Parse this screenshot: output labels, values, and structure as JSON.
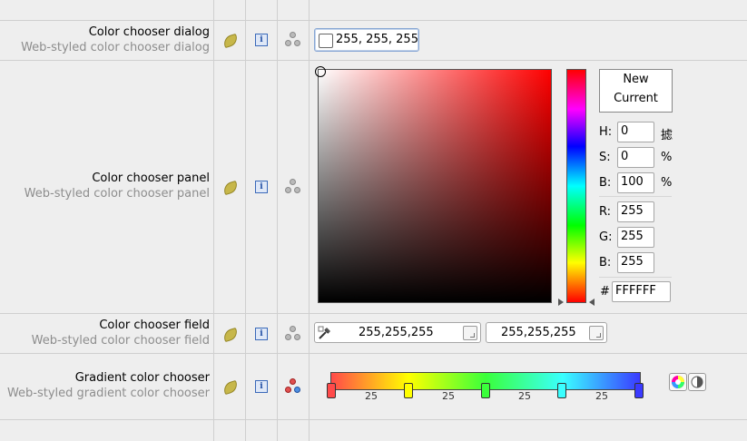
{
  "rows": [
    {
      "title": "Color chooser dialog",
      "subtitle": "Web-styled color chooser dialog"
    },
    {
      "title": "Color chooser panel",
      "subtitle": "Web-styled color chooser panel"
    },
    {
      "title": "Color chooser field",
      "subtitle": "Web-styled color chooser field"
    },
    {
      "title": "Gradient color chooser",
      "subtitle": "Web-styled gradient color chooser"
    }
  ],
  "icons": {
    "style": "leaf-icon",
    "info": "info-icon",
    "graph": "graph-icon"
  },
  "info_glyph": "i",
  "dialog": {
    "value": "255, 255, 255",
    "swatch_color": "#ffffff"
  },
  "panel": {
    "preview_new": "New",
    "preview_current": "Current",
    "h_label": "H:",
    "h_value": "0",
    "h_unit": "摅",
    "s_label": "S:",
    "s_value": "0",
    "s_unit": "%",
    "b_label": "B:",
    "b_value": "100",
    "b_unit": "%",
    "r_label": "R:",
    "r_value": "255",
    "g_label": "G:",
    "g_value": "255",
    "b2_label": "B:",
    "b2_value": "255",
    "hex_label": "#",
    "hex_value": "FFFFFF",
    "hue_color": "#ff0000"
  },
  "field": {
    "value1": "255,255,255",
    "value2": "255,255,255"
  },
  "gradient": {
    "stops": [
      {
        "color": "#ff4a4a",
        "position": 0
      },
      {
        "color": "#ffff00",
        "position": 0.25
      },
      {
        "color": "#3aff3a",
        "position": 0.5
      },
      {
        "color": "#3affff",
        "position": 0.75
      },
      {
        "color": "#3a3aff",
        "position": 1
      }
    ],
    "segment_labels": [
      "25",
      "25",
      "25",
      "25"
    ]
  }
}
